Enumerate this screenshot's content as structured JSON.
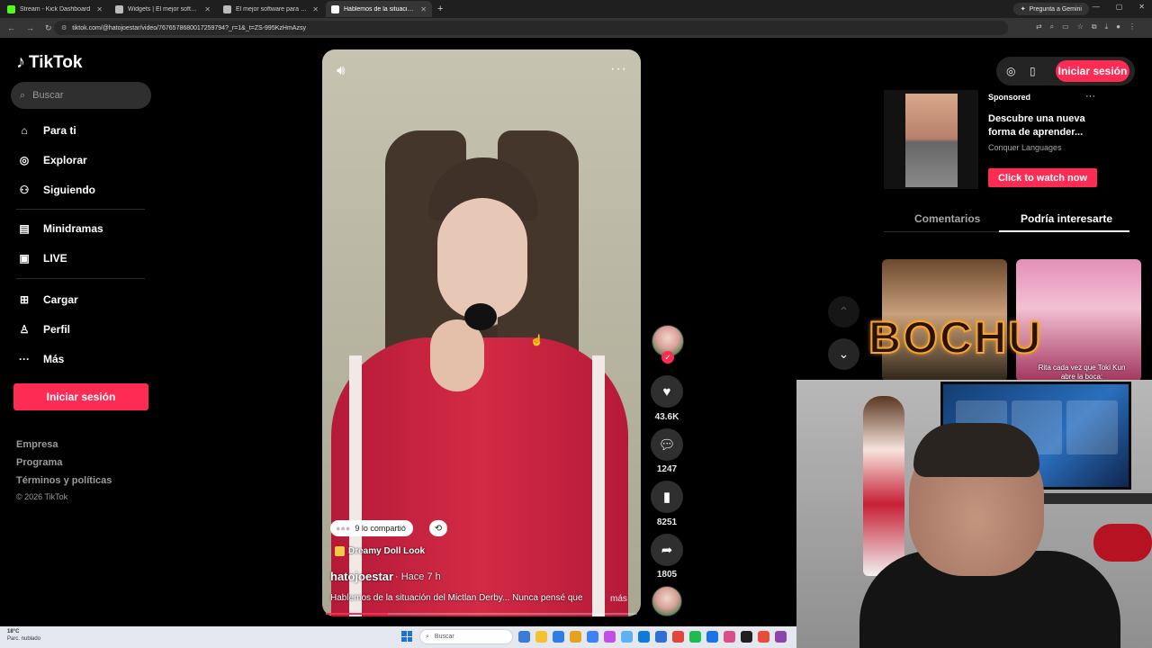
{
  "browser": {
    "tabs": [
      {
        "title": "Stream - Kick Dashboard",
        "fav_color": "#53fc18",
        "active": false
      },
      {
        "title": "Widgets | El mejor software pa",
        "fav_color": "#bbbbbb",
        "active": false
      },
      {
        "title": "El mejor software para potencia",
        "fav_color": "#bbbbbb",
        "active": false
      },
      {
        "title": "Hablemos de la situación del M",
        "fav_color": "#ffffff",
        "active": true
      }
    ],
    "new_tab": "+",
    "gemini_label": "Pregunta a Gemini",
    "url": "tiktok.com/@hatojoestar/video/7676578680017259794?_r=1&_t=ZS-995KzHmAzsy"
  },
  "sidebar": {
    "logo": "TikTok",
    "search_placeholder": "Buscar",
    "items": [
      {
        "label": "Para ti",
        "icon": "home-icon"
      },
      {
        "label": "Explorar",
        "icon": "compass-icon"
      },
      {
        "label": "Siguiendo",
        "icon": "following-icon"
      },
      {
        "label": "Minidramas",
        "icon": "minidrama-icon"
      },
      {
        "label": "LIVE",
        "icon": "live-icon"
      },
      {
        "label": "Cargar",
        "icon": "upload-icon"
      },
      {
        "label": "Perfil",
        "icon": "profile-icon"
      },
      {
        "label": "Más",
        "icon": "more-icon"
      }
    ],
    "login_label": "Iniciar sesión",
    "footer": [
      "Empresa",
      "Programa",
      "Términos y políticas"
    ],
    "copyright": "© 2026 TikTok"
  },
  "video": {
    "shared_text": "9 lo compartió",
    "effect": "Dreamy Doll Look",
    "author": "hatojoestar",
    "ago": "· Hace 7 h",
    "description": "Hablemos de la situación del Mictlan Derby... Nunca pensé que",
    "more": "más",
    "progress": 0.2
  },
  "actions": {
    "likes": "43.6K",
    "comments": "1247",
    "saves": "8251",
    "shares": "1805"
  },
  "right": {
    "login_label": "Iniciar sesión",
    "ad": {
      "sponsored": "Sponsored",
      "title": "Descubre una nueva forma de aprender...",
      "brand": "Conquer Languages",
      "cta": "Click to watch now"
    },
    "tabs": [
      "Comentarios",
      "Podría interesarte"
    ],
    "thumb_caption": "Rita cada vez que Toki Kun abre la boca:"
  },
  "overlay": {
    "logo_text": "BOCHU"
  },
  "taskbar": {
    "temp": "18°C",
    "weather": "Parc. nublado",
    "search": "Buscar",
    "app_colors": [
      "#3a7bd5",
      "#f2c230",
      "#2b7de9",
      "#e3a31f",
      "#3b82f6",
      "#c14ee8",
      "#5fb2f2",
      "#0f7ad8",
      "#2f6fd6",
      "#e2453c",
      "#1dbb52",
      "#1a73e8",
      "#d94e8a",
      "#202020",
      "#e74c3c",
      "#8e44ad"
    ]
  }
}
